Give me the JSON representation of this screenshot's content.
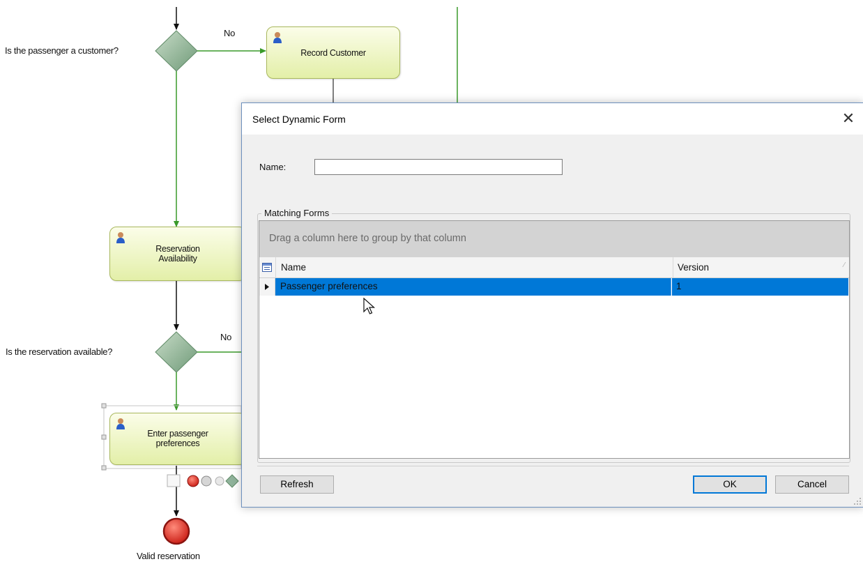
{
  "diagram": {
    "gateway1_question": "Is the passenger a customer?",
    "gateway1_no": "No",
    "task_record_customer": "Record Customer",
    "task_reservation_line1": "Reservation",
    "task_reservation_line2": "Availability",
    "gateway2_question": "Is the reservation available?",
    "gateway2_no": "No",
    "task_enter_line1": "Enter passenger",
    "task_enter_line2": "preferences",
    "end_event_label": "Valid reservation"
  },
  "dialog": {
    "title": "Select Dynamic Form",
    "close_glyph": "✕",
    "name_label": "Name:",
    "name_value": "",
    "group_title": "Matching Forms",
    "group_panel_hint": "Drag a column here to group by that column",
    "columns": {
      "name": "Name",
      "version": "Version"
    },
    "rows": [
      {
        "name": "Passenger preferences",
        "version": "1",
        "selected": true
      }
    ],
    "buttons": {
      "refresh": "Refresh",
      "ok": "OK",
      "cancel": "Cancel"
    }
  },
  "colors": {
    "flow_green": "#3a9a2a",
    "selection_blue": "#0078d7",
    "task_fill": "#e3efa8",
    "end_event_red": "#d9261c"
  },
  "icons": [
    "user-icon",
    "gateway-diamond",
    "end-event-circle",
    "close-icon",
    "column-chooser-icon",
    "row-indicator-icon",
    "mouse-cursor-icon",
    "resize-grip-icon"
  ]
}
